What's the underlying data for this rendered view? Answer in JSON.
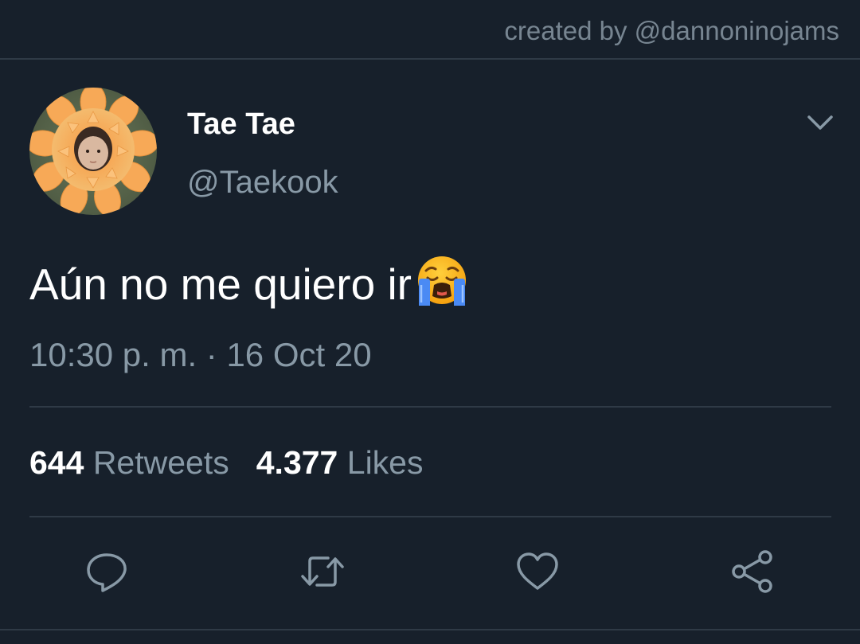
{
  "credit": "created by @dannoninojams",
  "tweet": {
    "display_name": "Tae Tae",
    "handle": "@Taekook",
    "text": "Aún no me quiero ir",
    "emoji": "loudly-crying-face",
    "timestamp": "10:30 p. m. · 16 Oct 20"
  },
  "stats": {
    "retweets_count": "644",
    "retweets_label": "Retweets",
    "likes_count": "4.377",
    "likes_label": "Likes"
  },
  "actions": [
    {
      "icon": "reply-icon"
    },
    {
      "icon": "retweet-icon"
    },
    {
      "icon": "like-icon"
    },
    {
      "icon": "share-icon"
    }
  ],
  "colors": {
    "background": "#17202b",
    "secondary_text": "#8899a6",
    "divider": "#2f3a46"
  }
}
